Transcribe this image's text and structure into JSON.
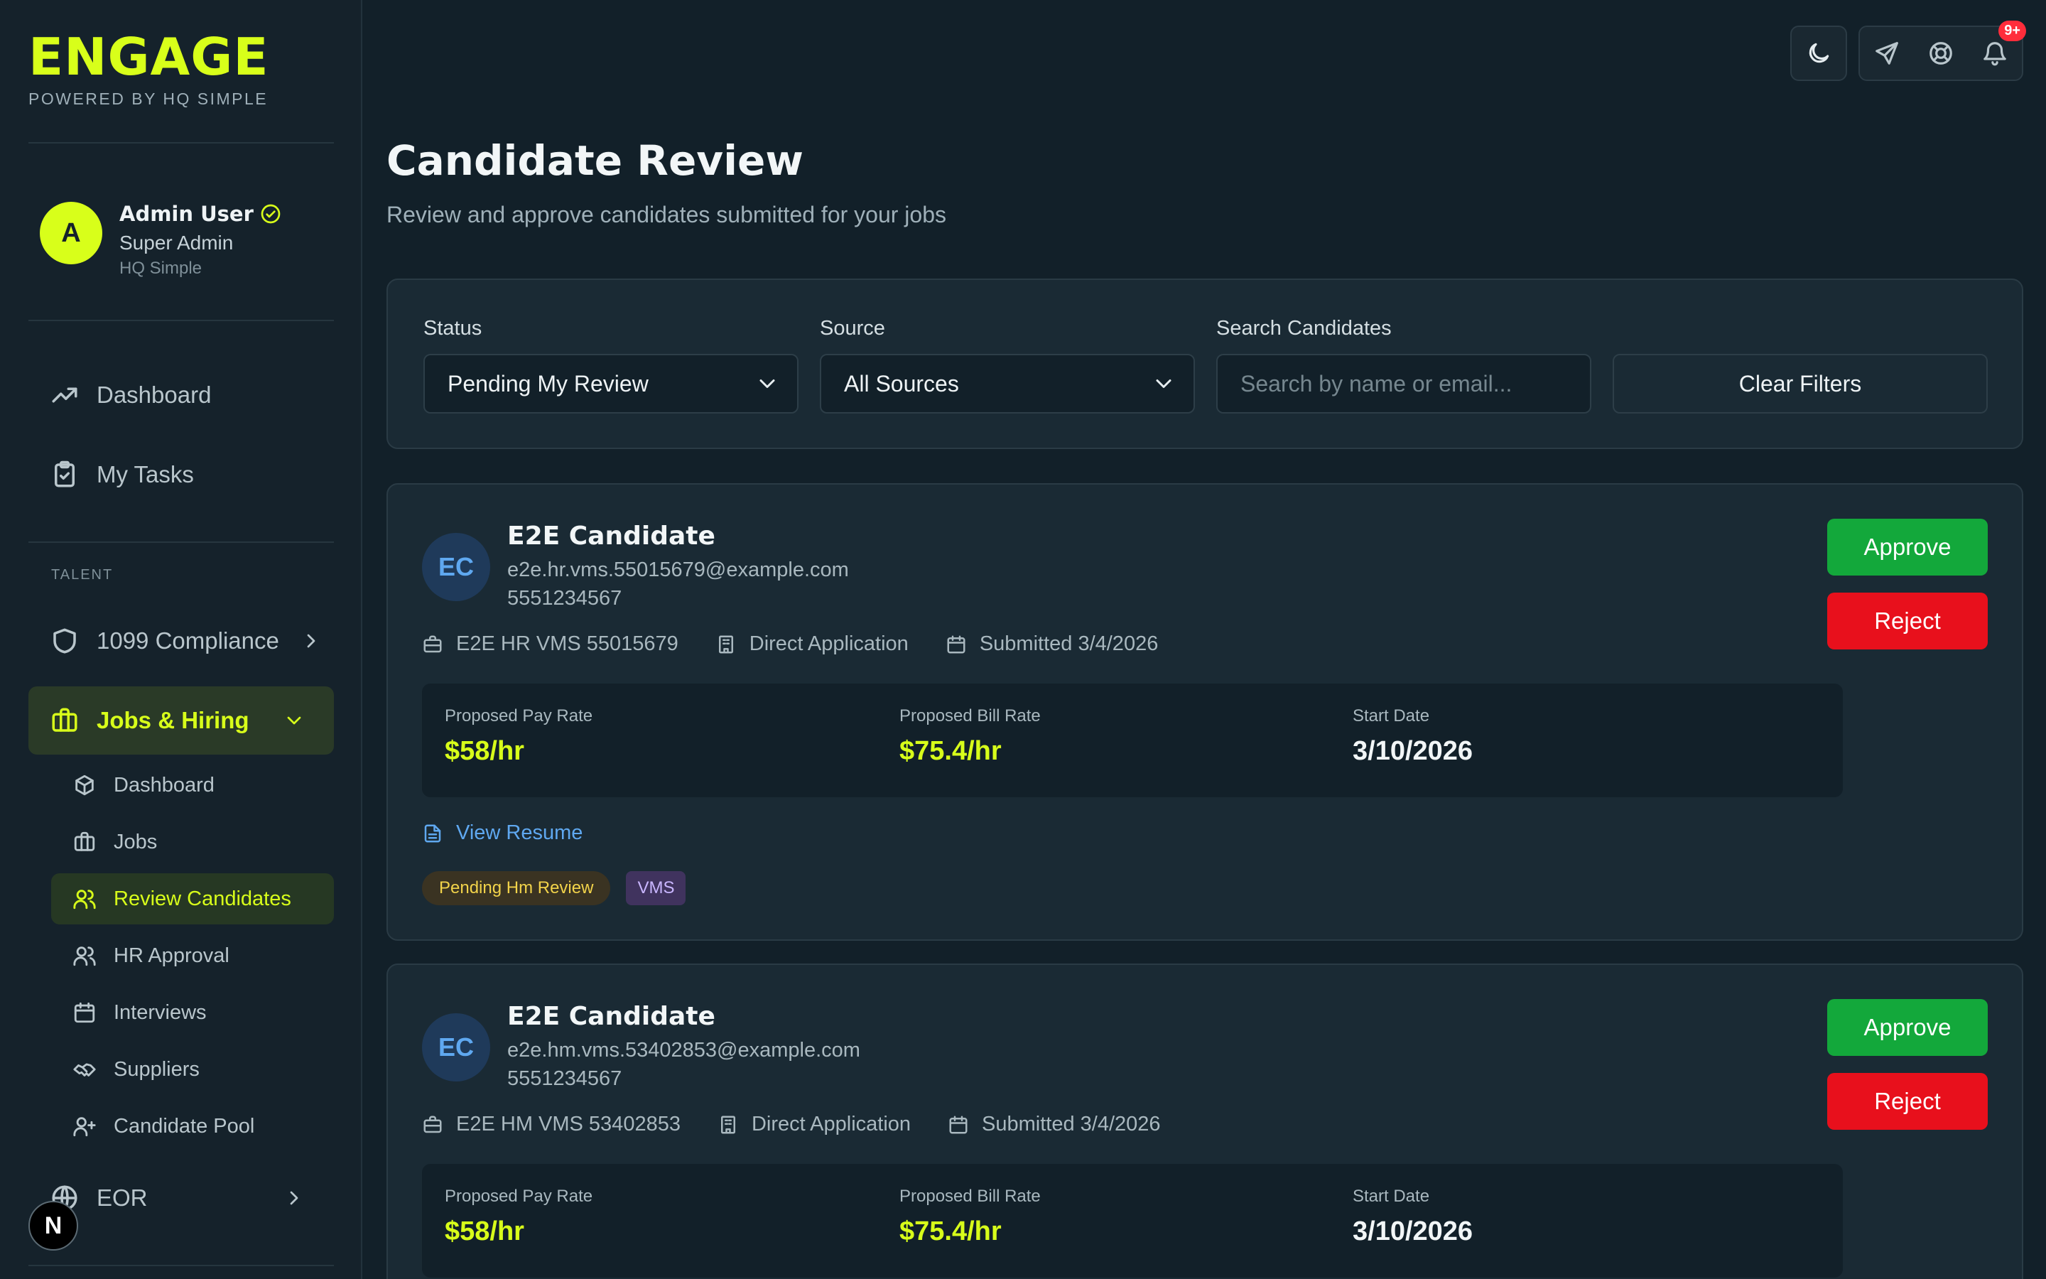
{
  "brand": {
    "title": "ENGAGE",
    "subtitle": "POWERED BY HQ SIMPLE",
    "accent": "#d8ff1a"
  },
  "user": {
    "initial": "A",
    "name": "Admin User",
    "role": "Super Admin",
    "org": "HQ Simple"
  },
  "nav": {
    "dashboard": "Dashboard",
    "my_tasks": "My Tasks",
    "section_talent": "TALENT",
    "compliance": "1099 Compliance",
    "jobs_hiring": "Jobs & Hiring",
    "eor": "EOR",
    "sub": {
      "dashboard": "Dashboard",
      "jobs": "Jobs",
      "review_candidates": "Review Candidates",
      "hr_approval": "HR Approval",
      "interviews": "Interviews",
      "suppliers": "Suppliers",
      "candidate_pool": "Candidate Pool"
    }
  },
  "topbar": {
    "notification_count": "9+"
  },
  "page": {
    "title": "Candidate Review",
    "subtitle": "Review and approve candidates submitted for your jobs"
  },
  "filters": {
    "status_label": "Status",
    "status_value": "Pending My Review",
    "source_label": "Source",
    "source_value": "All Sources",
    "search_label": "Search Candidates",
    "search_placeholder": "Search by name or email...",
    "clear_label": "Clear Filters"
  },
  "labels": {
    "pay_rate": "Proposed Pay Rate",
    "bill_rate": "Proposed Bill Rate",
    "start_date": "Start Date",
    "view_resume": "View Resume",
    "approve": "Approve",
    "reject": "Reject"
  },
  "candidates": [
    {
      "initials": "EC",
      "name": "E2E Candidate",
      "email": "e2e.hr.vms.55015679@example.com",
      "phone": "5551234567",
      "job": "E2E HR VMS 55015679",
      "source": "Direct Application",
      "submitted": "Submitted 3/4/2026",
      "pay_rate": "$58/hr",
      "bill_rate": "$75.4/hr",
      "start_date": "3/10/2026",
      "status_tag": "Pending Hm Review",
      "source_tag": "VMS"
    },
    {
      "initials": "EC",
      "name": "E2E Candidate",
      "email": "e2e.hm.vms.53402853@example.com",
      "phone": "5551234567",
      "job": "E2E HM VMS 53402853",
      "source": "Direct Application",
      "submitted": "Submitted 3/4/2026",
      "pay_rate": "$58/hr",
      "bill_rate": "$75.4/hr",
      "start_date": "3/10/2026"
    }
  ]
}
